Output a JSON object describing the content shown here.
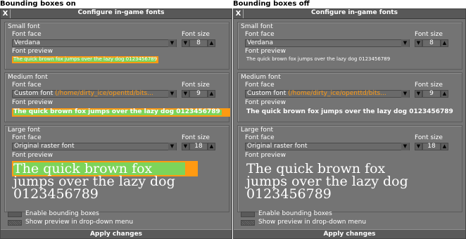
{
  "panels": [
    {
      "heading": "Bounding boxes on",
      "window_title": "Configure in-game fonts",
      "close_glyph": "X",
      "small": {
        "group_title": "Small font",
        "face_label": "Font face",
        "size_label": "Font size",
        "face_value": "Verdana",
        "face_path": "",
        "size_value": "8",
        "preview_label": "Font preview",
        "preview_text": "The quick brown fox jumps over the lazy dog 0123456789"
      },
      "medium": {
        "group_title": "Medium font",
        "face_label": "Font face",
        "size_label": "Font size",
        "face_value": "Custom font",
        "face_path": "(/home/dirty_ice/openttd/bits...",
        "size_value": "9",
        "preview_label": "Font preview",
        "preview_text": "The quick brown fox jumps over the lazy dog 0123456789"
      },
      "large": {
        "group_title": "Large font",
        "face_label": "Font face",
        "size_label": "Font size",
        "face_value": "Original raster font",
        "face_path": "",
        "size_value": "18",
        "preview_label": "Font preview",
        "preview_line1": "The quick brown fox",
        "preview_line2": "jumps over the lazy dog",
        "preview_line3": "0123456789"
      },
      "checkbox1_label": "Enable bounding boxes",
      "checkbox2_label": "Show preview in drop-down menu",
      "apply_label": "Apply changes"
    },
    {
      "heading": "Bounding boxes off",
      "window_title": "Configure in-game fonts",
      "close_glyph": "X",
      "small": {
        "group_title": "Small font",
        "face_label": "Font face",
        "size_label": "Font size",
        "face_value": "Verdana",
        "face_path": "",
        "size_value": "8",
        "preview_label": "Font preview",
        "preview_text": "The quick brown fox jumps over the lazy dog 0123456789"
      },
      "medium": {
        "group_title": "Medium font",
        "face_label": "Font face",
        "size_label": "Font size",
        "face_value": "Custom font",
        "face_path": "(/home/dirty_ice/openttd/bits...",
        "size_value": "9",
        "preview_label": "Font preview",
        "preview_text": "The quick brown fox jumps over the lazy dog 0123456789"
      },
      "large": {
        "group_title": "Large font",
        "face_label": "Font face",
        "size_label": "Font size",
        "face_value": "Original raster font",
        "face_path": "",
        "size_value": "18",
        "preview_label": "Font preview",
        "preview_line1": "The quick brown fox",
        "preview_line2": "jumps over the lazy dog",
        "preview_line3": "0123456789"
      },
      "checkbox1_label": "Enable bounding boxes",
      "checkbox2_label": "Show preview in drop-down menu",
      "apply_label": "Apply changes"
    }
  ],
  "icons": {
    "dropdown": "arrow-down-icon",
    "spin_down": "arrow-down-icon",
    "spin_up": "arrow-up-icon"
  },
  "colors": {
    "window_bg": "#747474",
    "titlebar": "#585858",
    "bbox_orange": "#ff9a12",
    "bbox_green": "#7cd45a",
    "text": "#ffffff"
  }
}
